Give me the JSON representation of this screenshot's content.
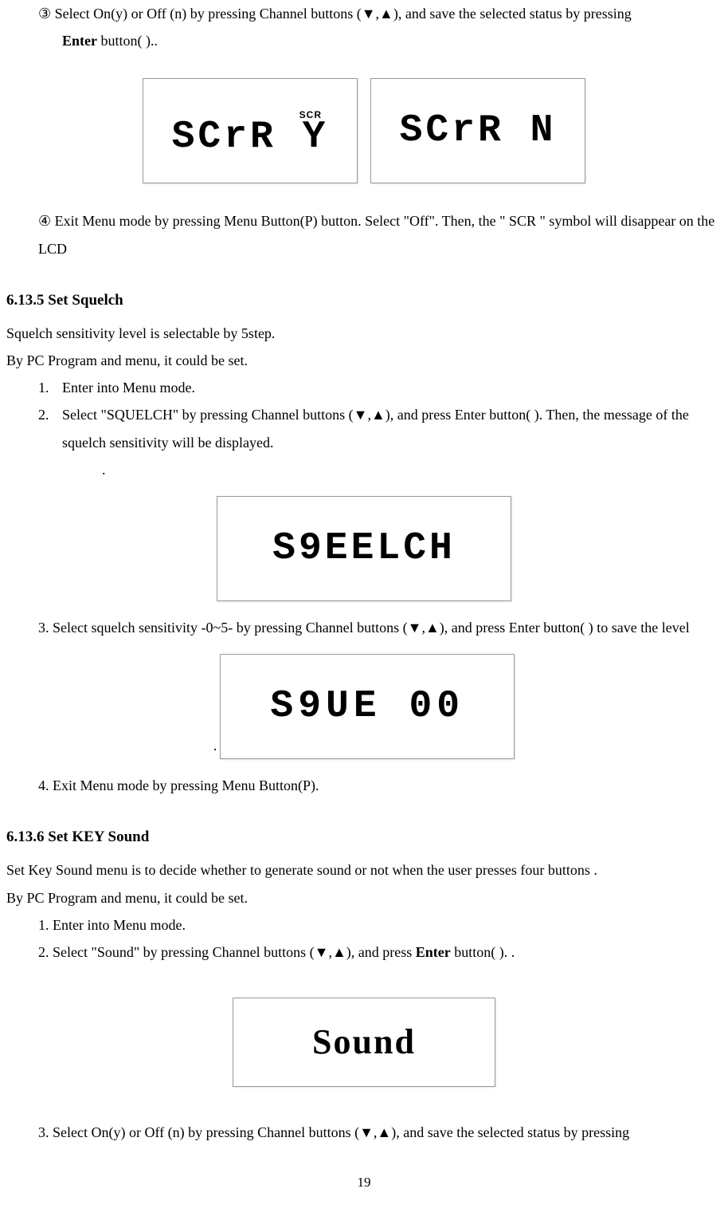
{
  "step3_prefix": "③",
  "step3_body_a": " Select On(y) or Off (n) by pressing Channel buttons (▼,▲), and save the selected status by pressing",
  "step3_line2_a": "Enter",
  "step3_line2_b": " button(      )..",
  "lcd_scr_label": "SCR",
  "lcd_scr_y": "SCrR Y",
  "lcd_scr_n": "SCrR  N",
  "step4_prefix": "④",
  "step4_body": " Exit Menu mode by pressing Menu Button(P) button.    Select \"Off\". Then, the \" SCR \" symbol will disappear on the LCD",
  "section_6135": "6.13.5 Set Squelch",
  "squelch_intro1": "Squelch sensitivity level is selectable by 5step.",
  "squelch_intro2": "By PC Program and menu, it could be set.",
  "sq_item1_num": "1.",
  "sq_item1": "Enter into Menu mode.",
  "sq_item2_num": "2.",
  "sq_item2": "Select \"SQUELCH\" by pressing Channel buttons (▼,▲), and press Enter button(       ).    Then, the message of the squelch sensitivity will be displayed.",
  "sq_dot": ".",
  "lcd_squelch": "S9EELCH",
  "sq_item3": "3. Select squelch sensitivity -0~5- by pressing Channel buttons (▼,▲), and press Enter button(       ) to save the level",
  "lcd_sque00": "S9UE 00",
  "sq_item4": "4. Exit Menu mode by pressing Menu Button(P).",
  "section_6136": "6.13.6 Set KEY Sound",
  "sound_intro1": "Set Key Sound menu is to decide whether to generate sound or not when the user presses four buttons .",
  "sound_intro2": "By PC Program and menu, it could be set.",
  "sound_item1": "1. Enter into Menu mode.",
  "sound_item2_a": "2. Select \"Sound\" by pressing Channel buttons (▼,▲), and press ",
  "sound_item2_b": "Enter",
  "sound_item2_c": " button(       ).    .",
  "lcd_sound": "Sound",
  "sound_item3": "3. Select On(y) or Off (n) by pressing Channel buttons (▼,▲), and save the selected status by pressing",
  "page_number": "19"
}
